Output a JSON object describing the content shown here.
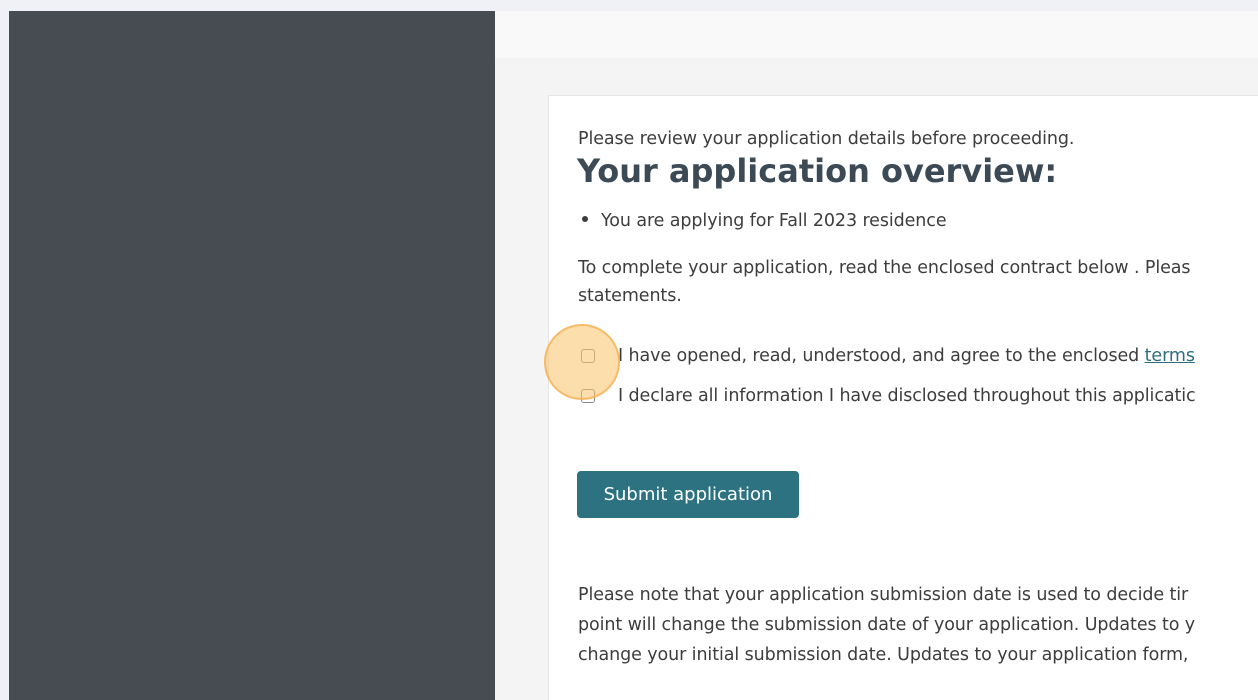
{
  "main": {
    "intro_text": "Please review your application details before proceeding.",
    "heading": "Your application overview:",
    "bullets": [
      "You are applying for Fall 2023 residence"
    ],
    "instruction": {
      "line1": "To complete your application, read the enclosed contract below . Pleas",
      "line2": "statements."
    },
    "checkboxes": [
      {
        "label_prefix": "I have opened, read, understood, and agree to the enclosed ",
        "link_text": "terms",
        "checked": false
      },
      {
        "label": "I declare all information I have disclosed throughout this applicatic",
        "checked": false
      }
    ],
    "submit_label": "Submit application",
    "note": {
      "line1": "Please note that your application submission date is used to decide tir",
      "line2": "point will change the submission date of your application. Updates to y",
      "line3": "change your initial submission date. Updates to your application form,"
    }
  },
  "colors": {
    "sidebar": "#474b52",
    "button": "#2c7281",
    "link": "#2d6f80",
    "heading": "#3b4a55",
    "highlight": "#fac369"
  }
}
